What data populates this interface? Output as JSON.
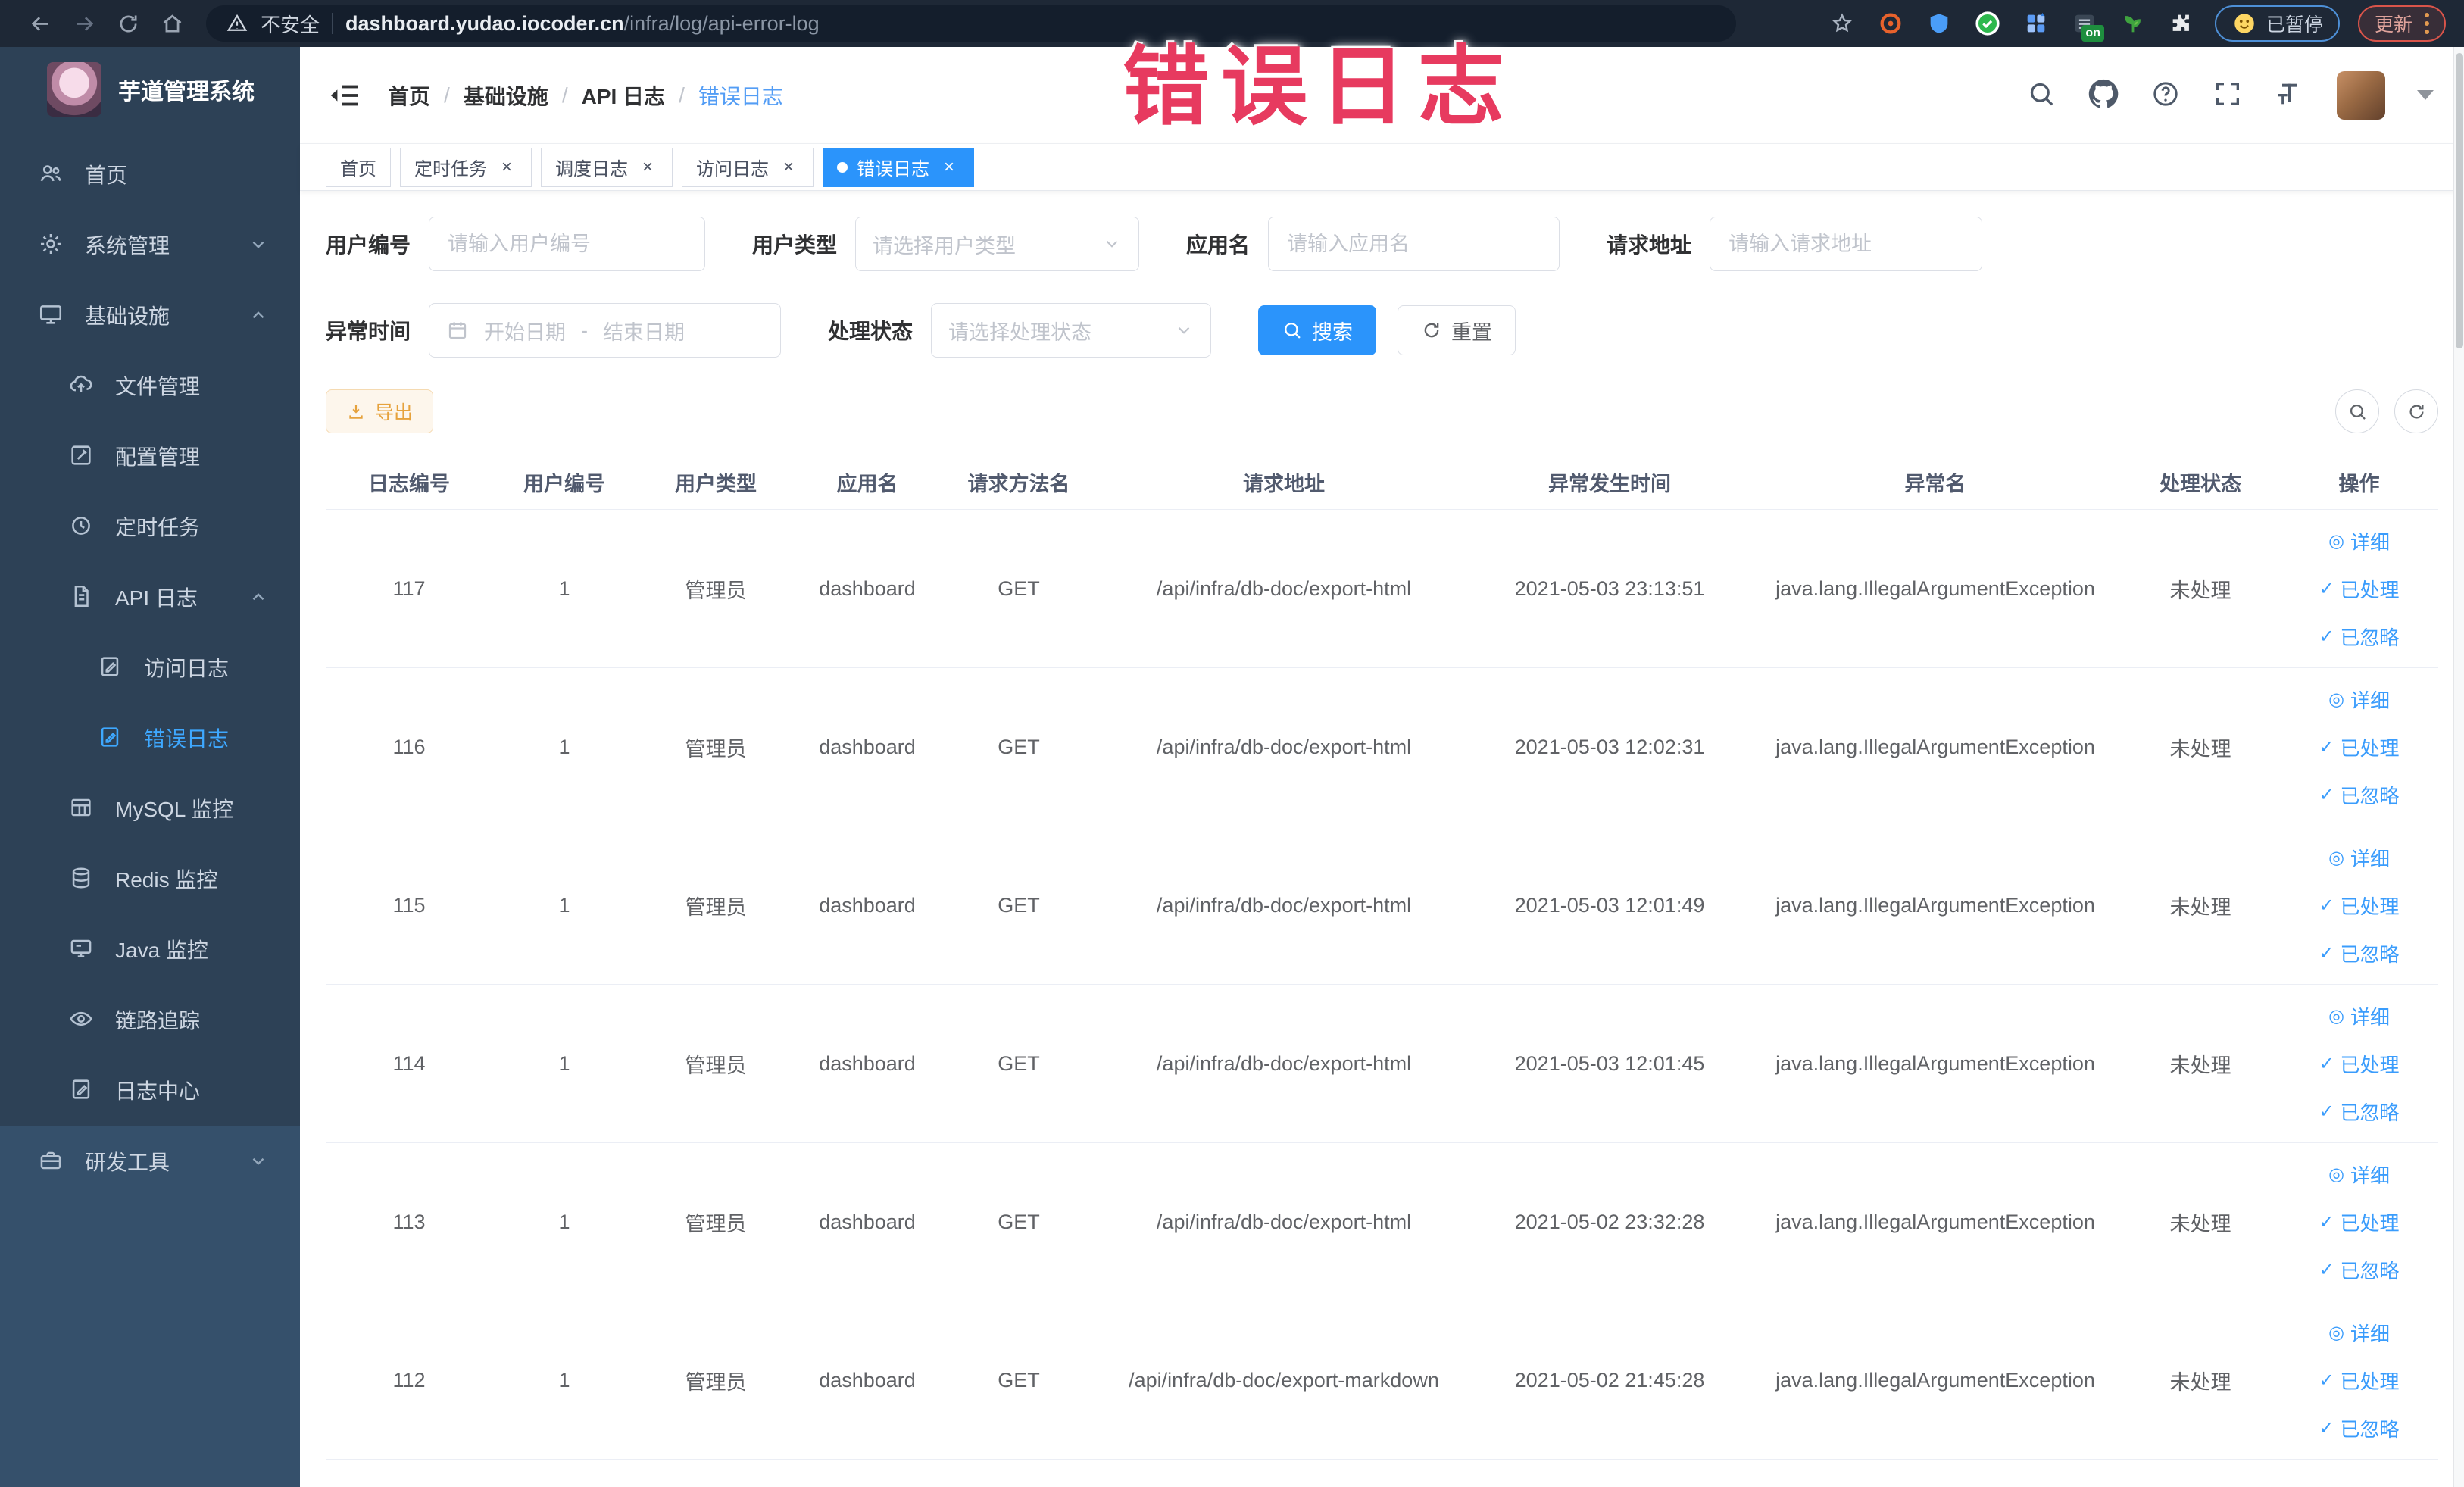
{
  "browser": {
    "security_label": "不安全",
    "url_host": "dashboard.yudao.iocoder.cn",
    "url_path": "/infra/log/api-error-log",
    "extension_badge": "on",
    "paused_label": "已暂停",
    "update_label": "更新"
  },
  "annotation": {
    "text": "错误日志"
  },
  "colors": {
    "accent": "#2b94fb",
    "link": "#3a9cfc",
    "warning_text": "#e6a23c",
    "annotation_red": "#e73a5f",
    "sidebar_bg": "#2d4156"
  },
  "sidebar": {
    "title": "芋道管理系统",
    "items": [
      {
        "id": "home",
        "label": "首页",
        "icon": "users",
        "level": 1
      },
      {
        "id": "system",
        "label": "系统管理",
        "icon": "gear",
        "level": 1,
        "chevron": "down"
      },
      {
        "id": "infra",
        "label": "基础设施",
        "icon": "monitor",
        "level": 1,
        "chevron": "up"
      },
      {
        "id": "file",
        "label": "文件管理",
        "icon": "cloud-upload",
        "level": 2
      },
      {
        "id": "config",
        "label": "配置管理",
        "icon": "edit-square",
        "level": 2
      },
      {
        "id": "job",
        "label": "定时任务",
        "icon": "clock",
        "level": 2
      },
      {
        "id": "api-log",
        "label": "API 日志",
        "icon": "doc",
        "level": 2,
        "chevron": "up"
      },
      {
        "id": "access-log",
        "label": "访问日志",
        "icon": "doc-edit",
        "level": 3
      },
      {
        "id": "error-log",
        "label": "错误日志",
        "icon": "doc-edit",
        "level": 3,
        "active": true
      },
      {
        "id": "mysql",
        "label": "MySQL 监控",
        "icon": "table-grid",
        "level": 2
      },
      {
        "id": "redis",
        "label": "Redis 监控",
        "icon": "db",
        "level": 2
      },
      {
        "id": "java",
        "label": "Java 监控",
        "icon": "screen",
        "level": 2
      },
      {
        "id": "trace",
        "label": "链路追踪",
        "icon": "eye",
        "level": 2
      },
      {
        "id": "log-center",
        "label": "日志中心",
        "icon": "doc-edit",
        "level": 2
      },
      {
        "id": "dev-tools",
        "label": "研发工具",
        "icon": "toolbox",
        "level": 1,
        "chevron": "down",
        "section": "bottom"
      }
    ]
  },
  "header": {
    "breadcrumb": [
      "首页",
      "基础设施",
      "API 日志",
      "错误日志"
    ],
    "separator": "/"
  },
  "tabs": [
    {
      "id": "home",
      "label": "首页",
      "closable": false,
      "active": false
    },
    {
      "id": "cron-job",
      "label": "定时任务",
      "closable": true,
      "active": false
    },
    {
      "id": "job-log",
      "label": "调度日志",
      "closable": true,
      "active": false
    },
    {
      "id": "access-log",
      "label": "访问日志",
      "closable": true,
      "active": false
    },
    {
      "id": "error-log",
      "label": "错误日志",
      "closable": true,
      "active": true
    }
  ],
  "filters": {
    "user_id": {
      "label": "用户编号",
      "placeholder": "请输入用户编号"
    },
    "user_type": {
      "label": "用户类型",
      "placeholder": "请选择用户类型"
    },
    "app_name": {
      "label": "应用名",
      "placeholder": "请输入应用名"
    },
    "request_url": {
      "label": "请求地址",
      "placeholder": "请输入请求地址"
    },
    "exception_time": {
      "label": "异常时间",
      "start_placeholder": "开始日期",
      "separator": "-",
      "end_placeholder": "结束日期"
    },
    "process_status": {
      "label": "处理状态",
      "placeholder": "请选择处理状态"
    },
    "search_label": "搜索",
    "reset_label": "重置"
  },
  "toolbar": {
    "export_label": "导出"
  },
  "table": {
    "columns": [
      "日志编号",
      "用户编号",
      "用户类型",
      "应用名",
      "请求方法名",
      "请求地址",
      "异常发生时间",
      "异常名",
      "处理状态",
      "操作"
    ],
    "actions": [
      "详细",
      "已处理",
      "已忽略"
    ],
    "rows": [
      {
        "log_id": "117",
        "user_id": "1",
        "user_type": "管理员",
        "app_name": "dashboard",
        "method": "GET",
        "url": "/api/infra/db-doc/export-html",
        "time": "2021-05-03 23:13:51",
        "exception": "java.lang.IllegalArgumentException",
        "status": "未处理"
      },
      {
        "log_id": "116",
        "user_id": "1",
        "user_type": "管理员",
        "app_name": "dashboard",
        "method": "GET",
        "url": "/api/infra/db-doc/export-html",
        "time": "2021-05-03 12:02:31",
        "exception": "java.lang.IllegalArgumentException",
        "status": "未处理"
      },
      {
        "log_id": "115",
        "user_id": "1",
        "user_type": "管理员",
        "app_name": "dashboard",
        "method": "GET",
        "url": "/api/infra/db-doc/export-html",
        "time": "2021-05-03 12:01:49",
        "exception": "java.lang.IllegalArgumentException",
        "status": "未处理"
      },
      {
        "log_id": "114",
        "user_id": "1",
        "user_type": "管理员",
        "app_name": "dashboard",
        "method": "GET",
        "url": "/api/infra/db-doc/export-html",
        "time": "2021-05-03 12:01:45",
        "exception": "java.lang.IllegalArgumentException",
        "status": "未处理"
      },
      {
        "log_id": "113",
        "user_id": "1",
        "user_type": "管理员",
        "app_name": "dashboard",
        "method": "GET",
        "url": "/api/infra/db-doc/export-html",
        "time": "2021-05-02 23:32:28",
        "exception": "java.lang.IllegalArgumentException",
        "status": "未处理"
      },
      {
        "log_id": "112",
        "user_id": "1",
        "user_type": "管理员",
        "app_name": "dashboard",
        "method": "GET",
        "url": "/api/infra/db-doc/export-markdown",
        "time": "2021-05-02 21:45:28",
        "exception": "java.lang.IllegalArgumentException",
        "status": "未处理"
      }
    ]
  }
}
